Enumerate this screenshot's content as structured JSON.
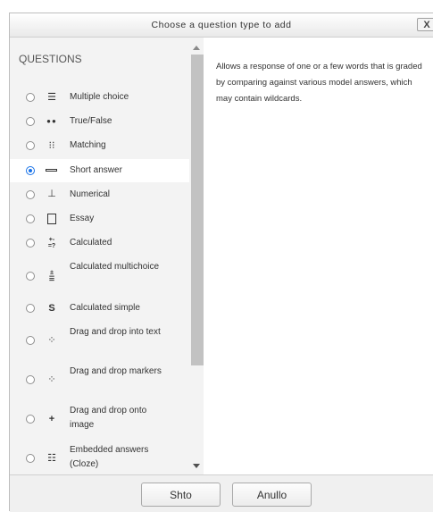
{
  "dialog": {
    "title": "Choose a question type to add",
    "close_label": "X"
  },
  "questions": {
    "heading": "QUESTIONS",
    "selected_index": 3,
    "items": [
      {
        "label": "Multiple choice",
        "icon": "multiple-choice-icon"
      },
      {
        "label": "True/False",
        "icon": "true-false-icon"
      },
      {
        "label": "Matching",
        "icon": "matching-icon"
      },
      {
        "label": "Short answer",
        "icon": "short-answer-icon"
      },
      {
        "label": "Numerical",
        "icon": "numerical-icon"
      },
      {
        "label": "Essay",
        "icon": "essay-icon"
      },
      {
        "label": "Calculated",
        "icon": "calculated-icon"
      },
      {
        "label": "Calculated multichoice",
        "icon": "calculated-multichoice-icon"
      },
      {
        "label": "Calculated simple",
        "icon": "calculated-simple-icon"
      },
      {
        "label": "Drag and drop into text",
        "icon": "drag-drop-text-icon"
      },
      {
        "label": "Drag and drop markers",
        "icon": "drag-drop-markers-icon"
      },
      {
        "label": "Drag and drop onto image",
        "icon": "drag-drop-image-icon"
      },
      {
        "label": "Embedded answers (Cloze)",
        "icon": "cloze-icon"
      }
    ]
  },
  "description": "Allows a response of one or a few words that is graded by comparing against various model answers, which may contain wildcards.",
  "footer": {
    "submit_label": "Shto",
    "cancel_label": "Anullo"
  },
  "colors": {
    "selected_radio": "#1a73e8",
    "list_background": "#f3f3f3"
  }
}
